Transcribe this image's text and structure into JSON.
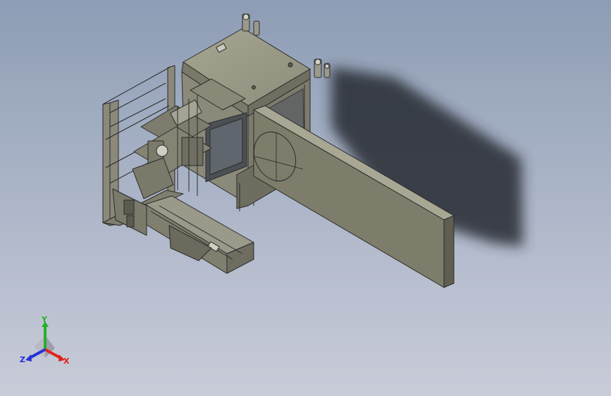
{
  "viewport": {
    "background_top": "#8d9db5",
    "background_bottom": "#c9ccd9",
    "model_color": "#8c8b78",
    "edge_color": "#2b2b2b"
  },
  "triad": {
    "x_label": "X",
    "y_label": "Y",
    "z_label": "Z",
    "x_color": "#e0241b",
    "y_color": "#23b02a",
    "z_color": "#2332d8"
  }
}
